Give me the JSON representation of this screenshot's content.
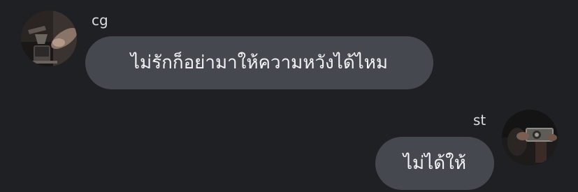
{
  "messages": [
    {
      "sender": "cg",
      "text": "ไม่รักก็อย่ามาให้ความหวังได้ไหม",
      "avatar": "coffee-pour-photo"
    },
    {
      "sender": "st",
      "text": "ไม่ได้ให้",
      "avatar": "camera-holding-photo"
    }
  ],
  "colors": {
    "background": "#1f2024",
    "bubble": "#46484f",
    "text": "#f4f4f6",
    "sender": "#dcdde0"
  }
}
